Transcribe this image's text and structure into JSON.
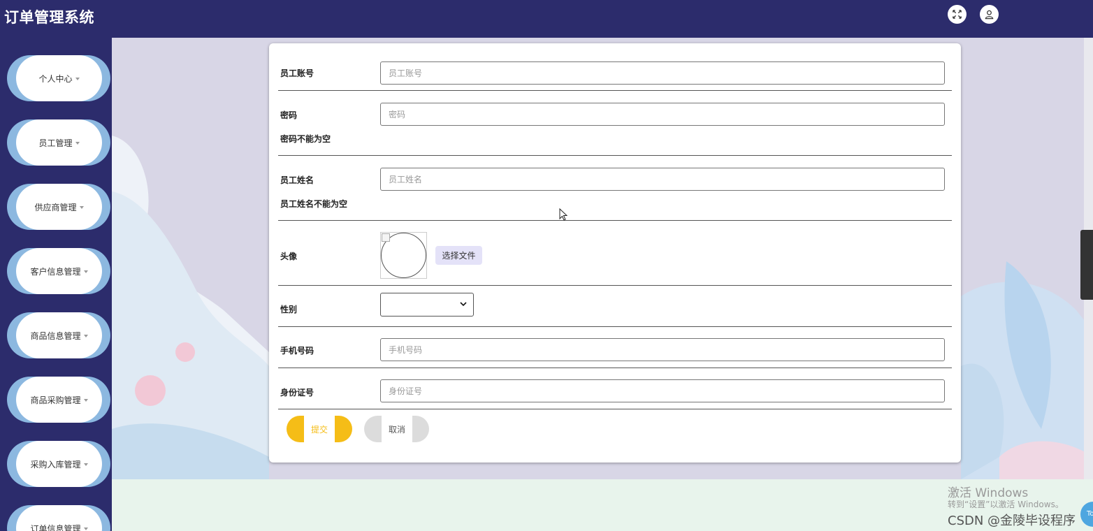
{
  "header": {
    "title": "订单管理系统",
    "icons": [
      "fullscreen-icon",
      "user-icon"
    ]
  },
  "sidebar": {
    "items": [
      {
        "label": "个人中心"
      },
      {
        "label": "员工管理"
      },
      {
        "label": "供应商管理"
      },
      {
        "label": "客户信息管理"
      },
      {
        "label": "商品信息管理"
      },
      {
        "label": "商品采购管理"
      },
      {
        "label": "采购入库管理"
      },
      {
        "label": "订单信息管理"
      }
    ]
  },
  "form": {
    "account": {
      "label": "员工账号",
      "placeholder": "员工账号"
    },
    "password": {
      "label": "密码",
      "placeholder": "密码",
      "error": "密码不能为空"
    },
    "name": {
      "label": "员工姓名",
      "placeholder": "员工姓名",
      "error": "员工姓名不能为空"
    },
    "avatar": {
      "label": "头像",
      "file_button": "选择文件"
    },
    "gender": {
      "label": "性别",
      "value": ""
    },
    "phone": {
      "label": "手机号码",
      "placeholder": "手机号码"
    },
    "id_card": {
      "label": "身份证号",
      "placeholder": "身份证号"
    },
    "submit_label": "提交",
    "cancel_label": "取消"
  },
  "watermark": {
    "title": "激活 Windows",
    "subtitle": "转到“设置”以激活 Windows。",
    "credit": "CSDN @金陵毕设程序"
  },
  "top_button_label": "To",
  "colors": {
    "nav_bg": "#2c2c6c",
    "submit": "#f5bd17",
    "menu_accent": "#8cb8e0"
  }
}
